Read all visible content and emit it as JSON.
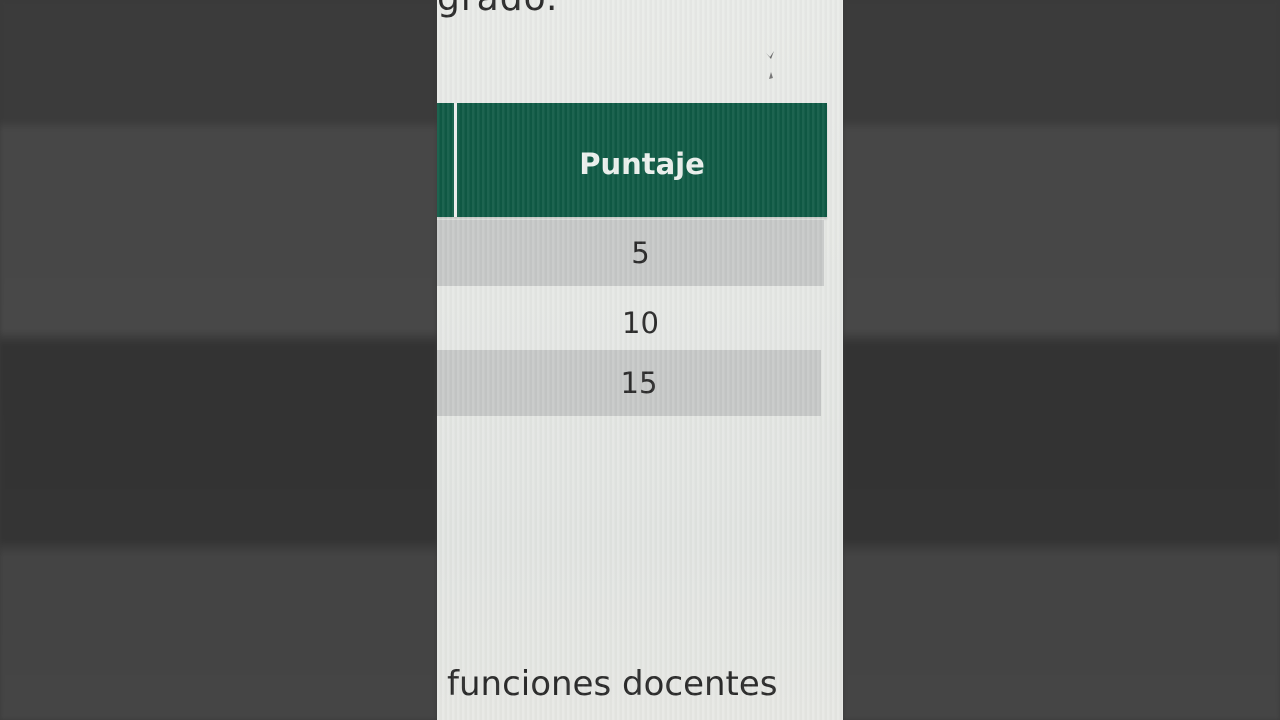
{
  "page": {
    "top_text": "grado.",
    "bottom_text": "funciones docentes"
  },
  "table": {
    "header": "Puntaje",
    "rows": [
      "5",
      "10",
      "15"
    ]
  },
  "colors": {
    "header_bg": "#0f5a45",
    "row_shade": "#c7c9c8"
  }
}
